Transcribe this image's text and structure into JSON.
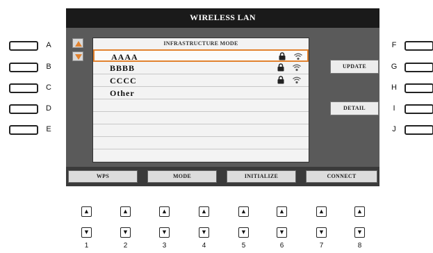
{
  "screen": {
    "title": "WIRELESS LAN",
    "list_header": "INFRASTRUCTURE MODE",
    "networks": [
      {
        "label": "AAAA",
        "lock": true,
        "wifi": true,
        "selected": true
      },
      {
        "label": "BBBB",
        "lock": true,
        "wifi": true,
        "selected": false
      },
      {
        "label": "CCCC",
        "lock": true,
        "wifi": true,
        "selected": false
      },
      {
        "label": "Other",
        "lock": false,
        "wifi": false,
        "selected": false
      }
    ],
    "update_label": "UPDATE",
    "detail_label": "DETAIL",
    "softkeys": [
      "WPS",
      "MODE",
      "INITIALIZE",
      "CONNECT"
    ],
    "accent_color": "#e2822e"
  },
  "left_buttons": [
    "A",
    "B",
    "C",
    "D",
    "E"
  ],
  "right_buttons": [
    "F",
    "G",
    "H",
    "I",
    "J"
  ],
  "knob_numbers": [
    "1",
    "2",
    "3",
    "4",
    "5",
    "6",
    "7",
    "8"
  ],
  "icons": {
    "up_arrow": "arrow-up-icon",
    "down_arrow": "arrow-down-icon",
    "lock": "lock-icon",
    "wifi": "wifi-icon"
  }
}
